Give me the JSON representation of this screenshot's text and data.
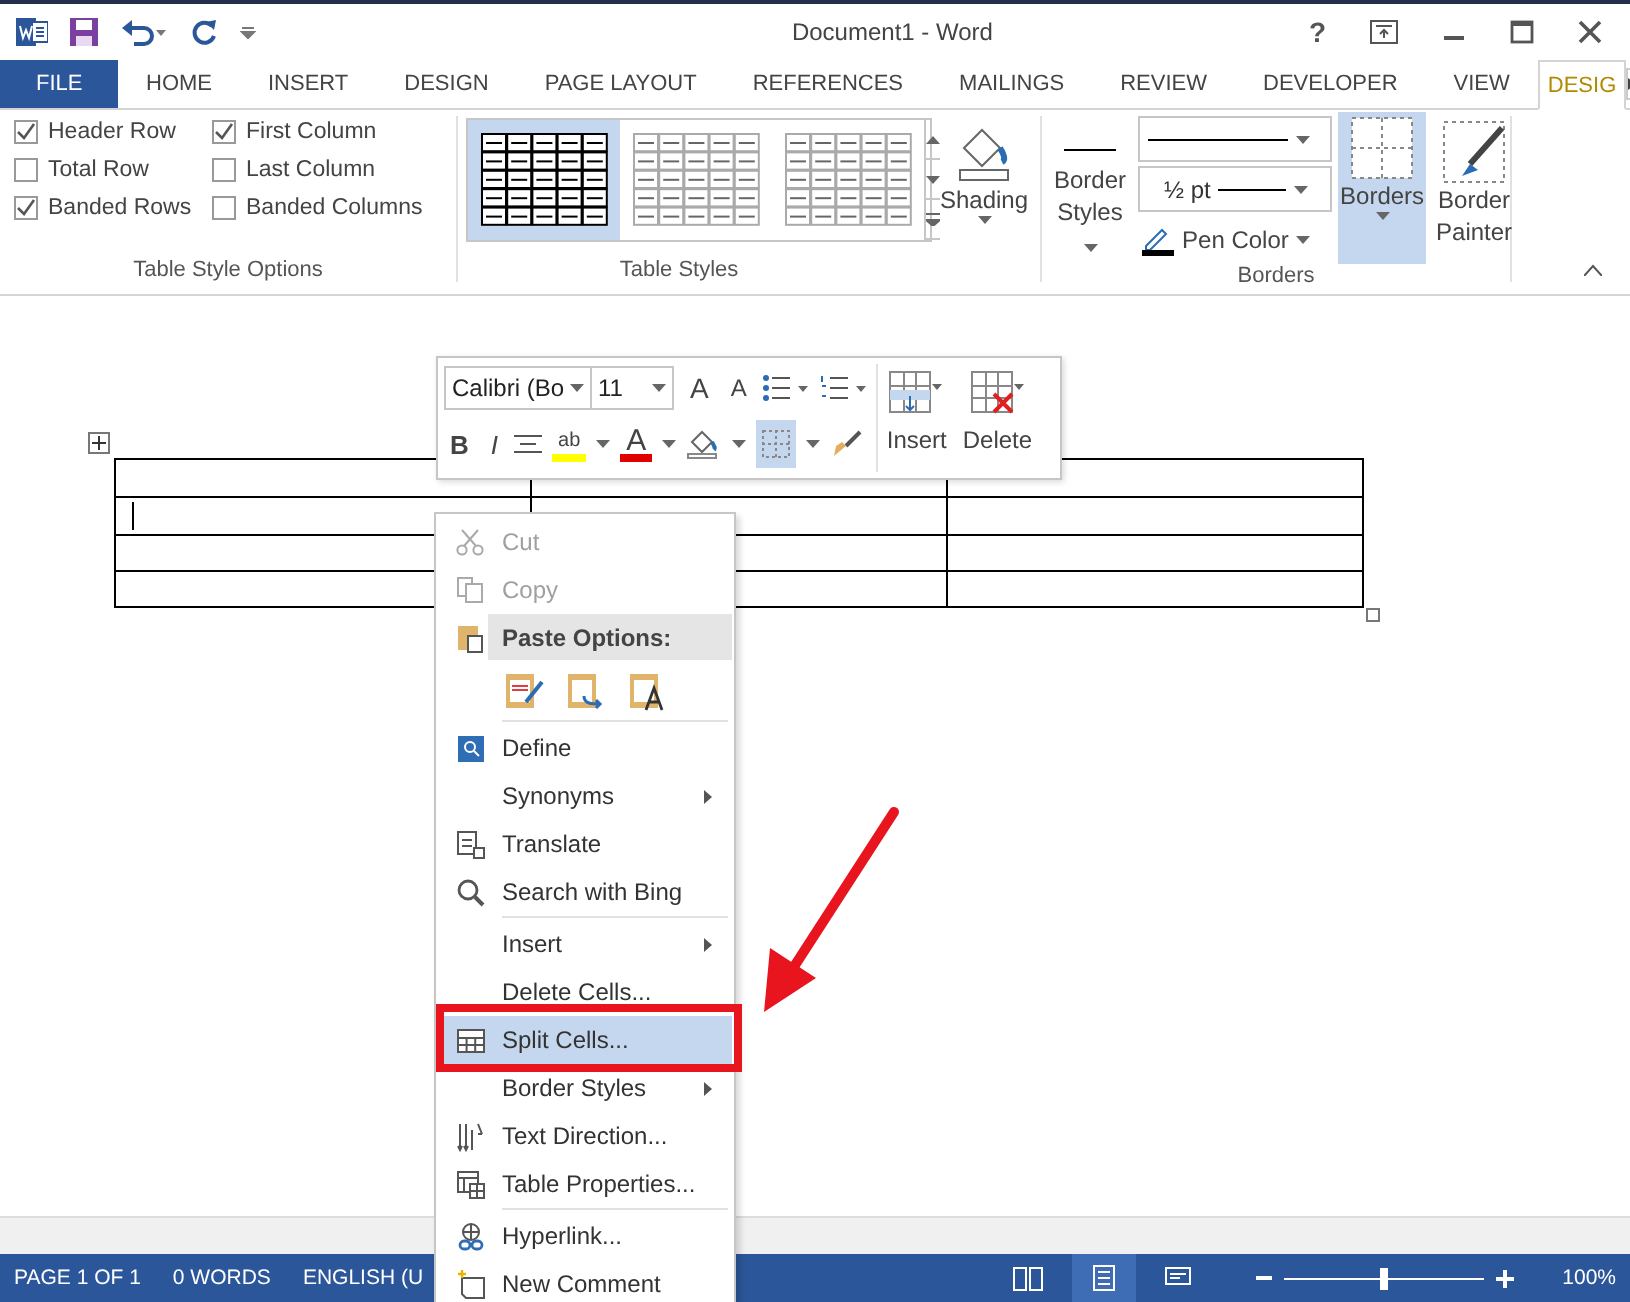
{
  "window": {
    "title": "Document1 - Word",
    "help": "?"
  },
  "tabs": [
    {
      "label": "FILE",
      "kind": "file",
      "selected": false
    },
    {
      "label": "HOME",
      "kind": "tab",
      "selected": false
    },
    {
      "label": "INSERT",
      "kind": "tab",
      "selected": false
    },
    {
      "label": "DESIGN",
      "kind": "tab",
      "selected": false
    },
    {
      "label": "PAGE LAYOUT",
      "kind": "tab",
      "selected": false
    },
    {
      "label": "REFERENCES",
      "kind": "tab",
      "selected": false
    },
    {
      "label": "MAILINGS",
      "kind": "tab",
      "selected": false
    },
    {
      "label": "REVIEW",
      "kind": "tab",
      "selected": false
    },
    {
      "label": "DEVELOPER",
      "kind": "tab",
      "selected": false
    },
    {
      "label": "VIEW",
      "kind": "tab",
      "selected": false
    },
    {
      "label": "DESIG",
      "kind": "contextual",
      "selected": true
    }
  ],
  "ribbon": {
    "table_style_options": {
      "label": "Table Style Options",
      "options": [
        {
          "label": "Header Row",
          "checked": true
        },
        {
          "label": "First Column",
          "checked": true
        },
        {
          "label": "Total Row",
          "checked": false
        },
        {
          "label": "Last Column",
          "checked": false
        },
        {
          "label": "Banded Rows",
          "checked": true
        },
        {
          "label": "Banded Columns",
          "checked": false
        }
      ]
    },
    "table_styles": {
      "label": "Table Styles",
      "gallery": [
        {
          "selected": true
        },
        {
          "selected": false
        },
        {
          "selected": false
        }
      ],
      "shading": "Shading"
    },
    "borders": {
      "label": "Borders",
      "border_styles": "Border Styles",
      "pen_weight": "½ pt",
      "pen_color": "Pen Color",
      "borders_button": {
        "label": "Borders",
        "selected": true
      },
      "border_painter": "Border Painter"
    }
  },
  "mini_toolbar": {
    "font": "Calibri (Bo",
    "size": "11",
    "grow_font": "A",
    "shrink_font": "A",
    "bold": "B",
    "italic": "I",
    "highlight": "ab",
    "font_color": "A",
    "borders_selected": true,
    "insert": "Insert",
    "delete": "Delete"
  },
  "context_menu": [
    {
      "kind": "item",
      "label": "Cut",
      "disabled": true,
      "submenu": false,
      "selected": false
    },
    {
      "kind": "item",
      "label": "Copy",
      "disabled": true,
      "submenu": false,
      "selected": false
    },
    {
      "kind": "header",
      "label": "Paste Options:"
    },
    {
      "kind": "paste_icons"
    },
    {
      "kind": "separator"
    },
    {
      "kind": "item",
      "label": "Define",
      "disabled": false,
      "submenu": false,
      "selected": false
    },
    {
      "kind": "item",
      "label": "Synonyms",
      "disabled": false,
      "submenu": true,
      "selected": false
    },
    {
      "kind": "item",
      "label": "Translate",
      "disabled": false,
      "submenu": false,
      "selected": false
    },
    {
      "kind": "item",
      "label": "Search with Bing",
      "disabled": false,
      "submenu": false,
      "selected": false
    },
    {
      "kind": "separator"
    },
    {
      "kind": "item",
      "label": "Insert",
      "disabled": false,
      "submenu": true,
      "selected": false
    },
    {
      "kind": "item",
      "label": "Delete Cells...",
      "disabled": false,
      "submenu": false,
      "selected": false
    },
    {
      "kind": "item",
      "label": "Split Cells...",
      "disabled": false,
      "submenu": false,
      "selected": true
    },
    {
      "kind": "item",
      "label": "Border Styles",
      "disabled": false,
      "submenu": true,
      "selected": false
    },
    {
      "kind": "item",
      "label": "Text Direction...",
      "disabled": false,
      "submenu": false,
      "selected": false
    },
    {
      "kind": "item",
      "label": "Table Properties...",
      "disabled": false,
      "submenu": false,
      "selected": false
    },
    {
      "kind": "separator"
    },
    {
      "kind": "item",
      "label": "Hyperlink...",
      "disabled": false,
      "submenu": false,
      "selected": false
    },
    {
      "kind": "item",
      "label": "New Comment",
      "disabled": false,
      "submenu": false,
      "selected": false
    }
  ],
  "status_bar": {
    "items": [
      "PAGE 1 OF 1",
      "0 WORDS",
      "ENGLISH (U"
    ],
    "views": [
      {
        "selected": false
      },
      {
        "selected": true
      },
      {
        "selected": false
      }
    ],
    "zoom": {
      "level": 0.5,
      "label": "100%"
    }
  }
}
